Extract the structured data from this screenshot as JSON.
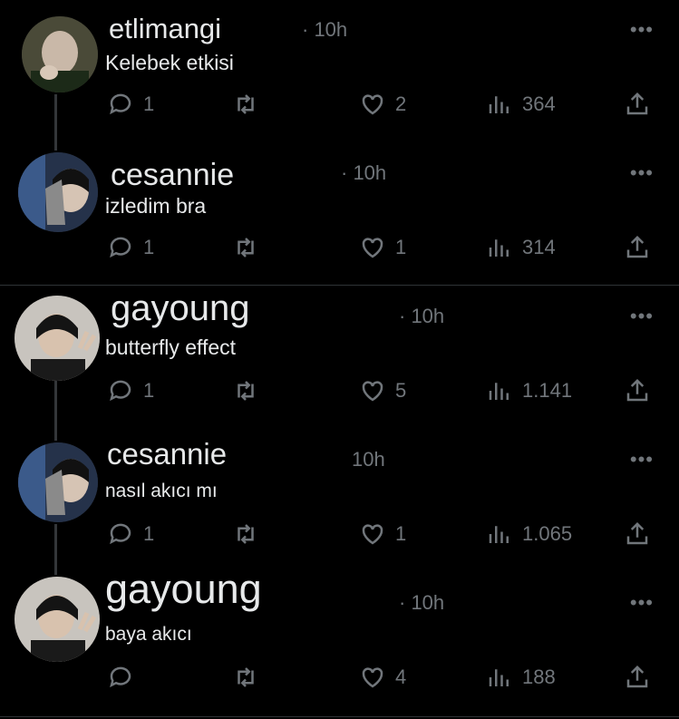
{
  "posts": [
    {
      "name": "etlimangi",
      "time": "· 10h",
      "text": "Kelebek etkisi",
      "replies": "1",
      "likes": "2",
      "views": "364"
    },
    {
      "name": "cesannie",
      "time": "· 10h",
      "text": "izledim bra",
      "replies": "1",
      "likes": "1",
      "views": "314"
    },
    {
      "name": "gayoung",
      "time": "· 10h",
      "text": "butterfly effect",
      "replies": "1",
      "likes": "5",
      "views": "1.141"
    },
    {
      "name": "cesannie",
      "time": "10h",
      "text": "nasıl akıcı mı",
      "replies": "1",
      "likes": "1",
      "views": "1.065"
    },
    {
      "name": "gayoung",
      "time": "· 10h",
      "text": "baya akıcı",
      "replies": "",
      "likes": "4",
      "views": "188"
    }
  ],
  "more_label": "•••",
  "icons": {
    "reply": "reply-icon",
    "repost": "repost-icon",
    "like": "heart-icon",
    "views": "views-icon",
    "share": "share-icon"
  },
  "colors": {
    "background": "#000000",
    "text": "#e7e9ea",
    "muted": "#71767b",
    "line": "#333639"
  }
}
